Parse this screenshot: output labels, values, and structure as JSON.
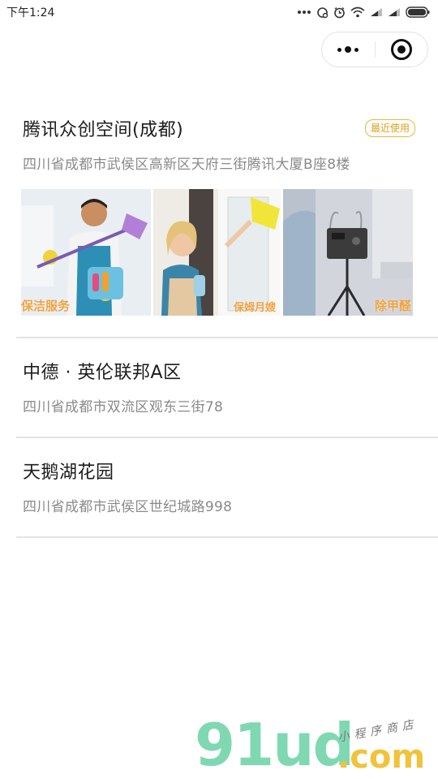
{
  "status_bar": {
    "time": "下午1:24",
    "icons": [
      "more-dots-icon",
      "sync-icon",
      "alarm-icon",
      "wifi-icon",
      "signal-icon",
      "signal-icon",
      "battery-icon"
    ]
  },
  "capsule": {
    "menu_icon": "more-dots-icon",
    "close_icon": "target-circle-icon"
  },
  "addresses": [
    {
      "name": "腾讯众创空间(成都)",
      "badge": "最近使用",
      "detail": "四川省成都市武侯区高新区天府三街腾讯大厦B座8楼",
      "services": [
        {
          "label": "保洁服务"
        },
        {
          "label": "保姆月嫂"
        },
        {
          "label": "除甲醛"
        }
      ]
    },
    {
      "name": "中德 · 英伦联邦A区",
      "detail": "四川省成都市双流区观东三街78"
    },
    {
      "name": "天鹅湖花园",
      "detail": "四川省成都市武侯区世纪城路998"
    }
  ],
  "watermark": {
    "brand": "91ud",
    "domain": ".com",
    "subtitle": "小程序商店"
  },
  "colors": {
    "badge": "#d9a21a",
    "service_label": "#f2a341",
    "divider": "#e3e3e3",
    "detail_text": "#8a8a8a"
  }
}
